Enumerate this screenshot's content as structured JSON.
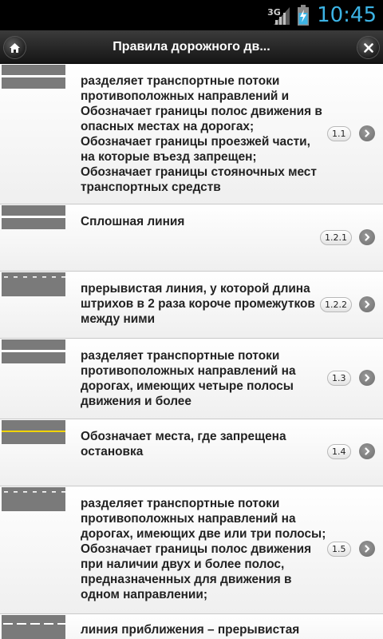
{
  "status_bar": {
    "network": "3G",
    "time": "10:45",
    "time_color": "#3cb3e4"
  },
  "header": {
    "title": "Правила дорожного дв...",
    "home_icon": "home-icon",
    "close_icon": "close-icon"
  },
  "items": [
    {
      "marking": "double-solid",
      "lines": [
        "разделяет транспортные потоки",
        "противоположных направлений и",
        "Обозначает границы полос движения в",
        "опасных местах на дорогах;",
        "Обозначает границы проезжей части,",
        "на которые въезд запрещен;",
        "Обозначает границы стояночных мест",
        "транспортных средств"
      ],
      "code": "1.1"
    },
    {
      "marking": "double-solid",
      "lines": [
        "Сплошная линия"
      ],
      "code": "1.2.1"
    },
    {
      "marking": "short-dash",
      "lines": [
        "прерывистая линия, у которой длина",
        "штрихов в 2 раза короче промежутков",
        "между ними"
      ],
      "code": "1.2.2"
    },
    {
      "marking": "double-solid",
      "lines": [
        "разделяет транспортные потоки",
        "противоположных направлений на",
        "дорогах, имеющих четыре полосы",
        "движения и более"
      ],
      "code": "1.3"
    },
    {
      "marking": "yellow-line",
      "lines": [
        "Обозначает места, где запрещена",
        "остановка"
      ],
      "code": "1.4"
    },
    {
      "marking": "short-dash",
      "lines": [
        "разделяет транспортные потоки",
        "противоположных направлений на",
        "дорогах, имеющих две или три полосы;",
        "Обозначает границы полос движения",
        "при наличии двух и более полос,",
        "предназначенных для движения в",
        "одном направлении;"
      ],
      "code": "1.5"
    },
    {
      "marking": "long-dash",
      "lines": [
        "линия приближения – прерывистая"
      ],
      "code": ""
    }
  ]
}
